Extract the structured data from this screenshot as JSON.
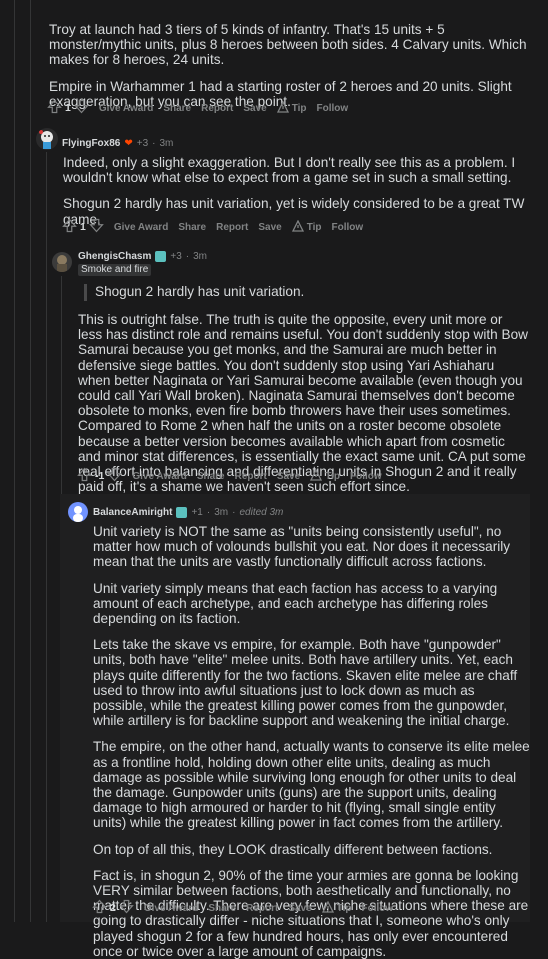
{
  "comments": [
    {
      "id": "c0",
      "paragraphs": [
        "Troy at launch had 3 tiers of 5 kinds of infantry. That's 15 units + 5 monster/mythic units, plus 8 heroes between both sides. 4 Calvary units. Which makes for 8 heroes, 24 units.",
        "Empire in Warhammer 1 had a starting roster of 2 heroes and 20 units. Slight exaggeration, but you can see the point."
      ],
      "score": "1",
      "actions": [
        "Give Award",
        "Share",
        "Report",
        "Save",
        "Tip",
        "Follow"
      ]
    },
    {
      "id": "c1",
      "author": "FlyingFox86",
      "flair_points": "+3",
      "time": "3m",
      "paragraphs": [
        "Indeed, only a slight exaggeration. But I don't really see this as a problem. I wouldn't know what else to expect from a game set in such a small setting.",
        "Shogun 2 hardly has unit variation, yet is widely considered to be a great TW game."
      ],
      "score": "1",
      "actions": [
        "Give Award",
        "Share",
        "Report",
        "Save",
        "Tip",
        "Follow"
      ]
    },
    {
      "id": "c2",
      "author": "GhengisChasm",
      "flair_points": "+3",
      "time": "3m",
      "flair": "Smoke and fire",
      "quote": "Shogun 2 hardly has unit variation.",
      "paragraphs": [
        "This is outright false. The truth is quite the opposite, every unit more or less has distinct role and remains useful. You don't suddenly stop with Bow Samurai because you get monks, and the Samurai are much better in defensive siege battles. You don't suddenly stop using Yari Ashiaharu when better Naginata or Yari Samurai become available (even though you could call Yari Wall broken). Naginata Samurai themselves don't become obsolete to monks, even fire bomb throwers have their uses sometimes. Compared to Rome 2 when half the units on a roster become obsolete because a better version becomes available which apart from cosmetic and minor stat differences, is essentially the exact same unit. CA put some real effort into balancing and differentiating units in Shogun 2 and it really paid off, it's a shame we haven't seen such effort since."
      ],
      "score": "-1",
      "actions": [
        "Give Award",
        "Share",
        "Report",
        "Save",
        "Tip",
        "Follow"
      ]
    },
    {
      "id": "c3",
      "author": "BalanceAmiright",
      "flair_points": "+1",
      "time": "3m",
      "edited": "edited 3m",
      "paragraphs": [
        "Unit variety is NOT the same as \"units being consistently useful\", no matter how much of volounds bullshit you eat. Nor does it necessarily mean that the units are vastly functionally difficult across factions.",
        "Unit variety simply means that each faction has access to a varying amount of each archetype, and each archetype has differing roles depending on its faction.",
        "Lets take the skave vs empire, for example. Both have \"gunpowder\" units, both have \"elite\" melee units. Both have artillery units. Yet, each plays quite differently for the two factions. Skaven elite melee are chaff used to throw into awful situations just to lock down as much as possible, while the greatest killing power comes from the gunpowder, while artillery is for backline support and weakening the initial charge.",
        "The empire, on the other hand, actually wants to conserve its elite melee as a frontline hold, holding down other elite units, dealing as much damage as possible while surviving long enough for other units to deal the damage. Gunpowder units (guns) are the support units, dealing damage to high armoured or harder to hit (flying, small single entity units) while the greatest killing power in fact comes from the artillery.",
        "On top of all this, they LOOK drastically different between factions.",
        "Fact is, in shogun 2, 90% of the time your armies are gonna be looking VERY similar between factions, both aesthetically and functionally, no matter the difficulty. There are very few, niche situations where these are going to drastically differ - niche situations that I, someone who's only played shogun 2 for a few hundred hours, has only ever encountered once or twice over a large amount of campaigns."
      ],
      "score": "2",
      "actions": [
        "Give Award",
        "Share",
        "Report",
        "Save",
        "Tip",
        "Follow"
      ]
    }
  ],
  "colors": {
    "bg": "#1a1a1b",
    "text": "#d7dadc",
    "muted": "#818384",
    "rail": "#343536"
  }
}
